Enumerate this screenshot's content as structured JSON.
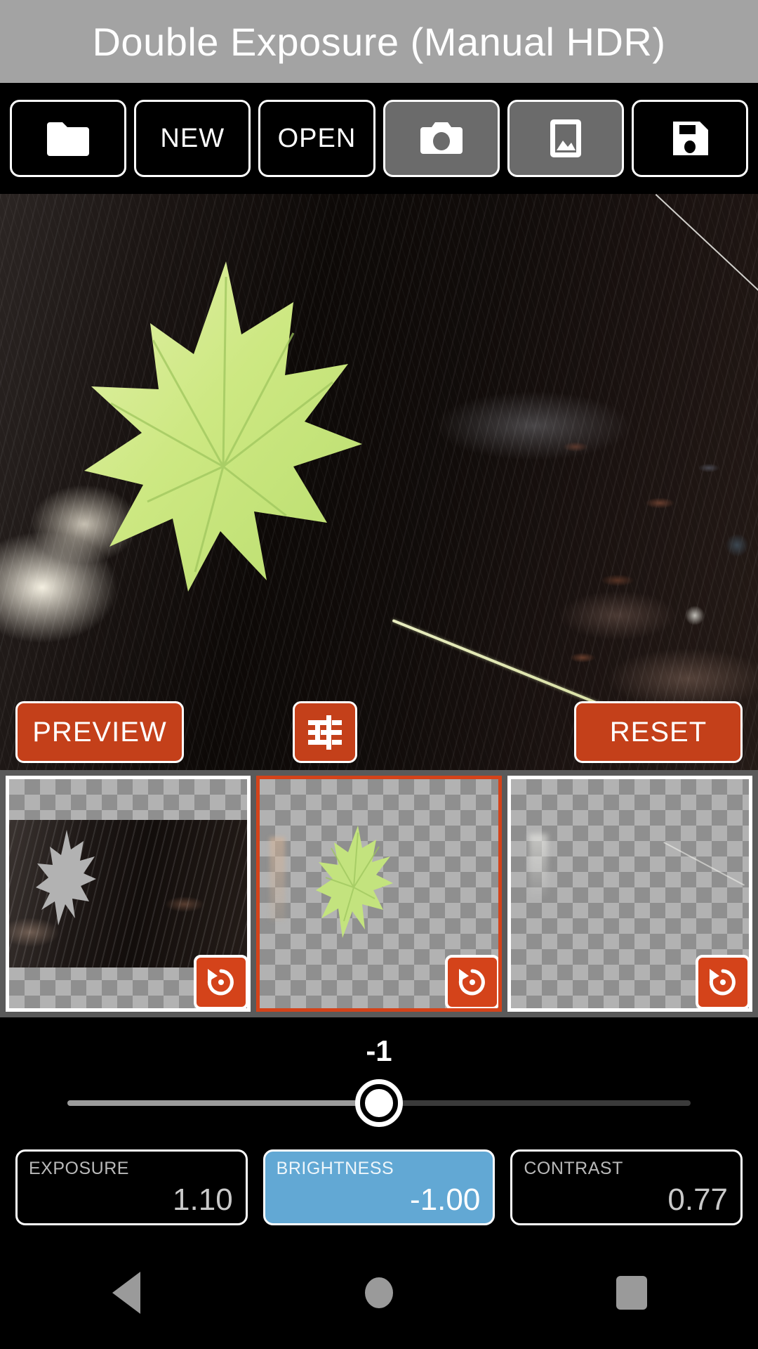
{
  "app": {
    "title": "Double Exposure (Manual HDR)",
    "accent_orange": "#c4401a",
    "accent_blue": "#62a8d4",
    "titlebar_bg": "#a3a3a3"
  },
  "toolbar": {
    "buttons": [
      {
        "name": "folder",
        "label": "",
        "icon": "folder-icon",
        "active": false
      },
      {
        "name": "new",
        "label": "NEW",
        "icon": "",
        "active": false
      },
      {
        "name": "open",
        "label": "OPEN",
        "icon": "",
        "active": false
      },
      {
        "name": "camera",
        "label": "",
        "icon": "camera-icon",
        "active": true
      },
      {
        "name": "gallery",
        "label": "",
        "icon": "image-icon",
        "active": true
      },
      {
        "name": "save",
        "label": "",
        "icon": "floppy-disk-icon",
        "active": false
      }
    ]
  },
  "canvas": {
    "preview_label": "PREVIEW",
    "reset_label": "RESET",
    "tune_icon": "tune-sliders-icon"
  },
  "layers": [
    {
      "name": "layer-background",
      "selected": false,
      "revert_icon": "revert-icon"
    },
    {
      "name": "layer-leaf",
      "selected": true,
      "revert_icon": "revert-icon"
    },
    {
      "name": "layer-empty",
      "selected": false,
      "revert_icon": "revert-icon"
    }
  ],
  "slider": {
    "value_label": "-1",
    "position_percent": 50,
    "min": -2,
    "max": 2
  },
  "params": [
    {
      "label": "EXPOSURE",
      "value": "1.10",
      "active": false
    },
    {
      "label": "BRIGHTNESS",
      "value": "-1.00",
      "active": true
    },
    {
      "label": "CONTRAST",
      "value": "0.77",
      "active": false
    }
  ],
  "navbar": {
    "back": "back-triangle-icon",
    "home": "home-circle-icon",
    "recents": "recents-square-icon"
  }
}
